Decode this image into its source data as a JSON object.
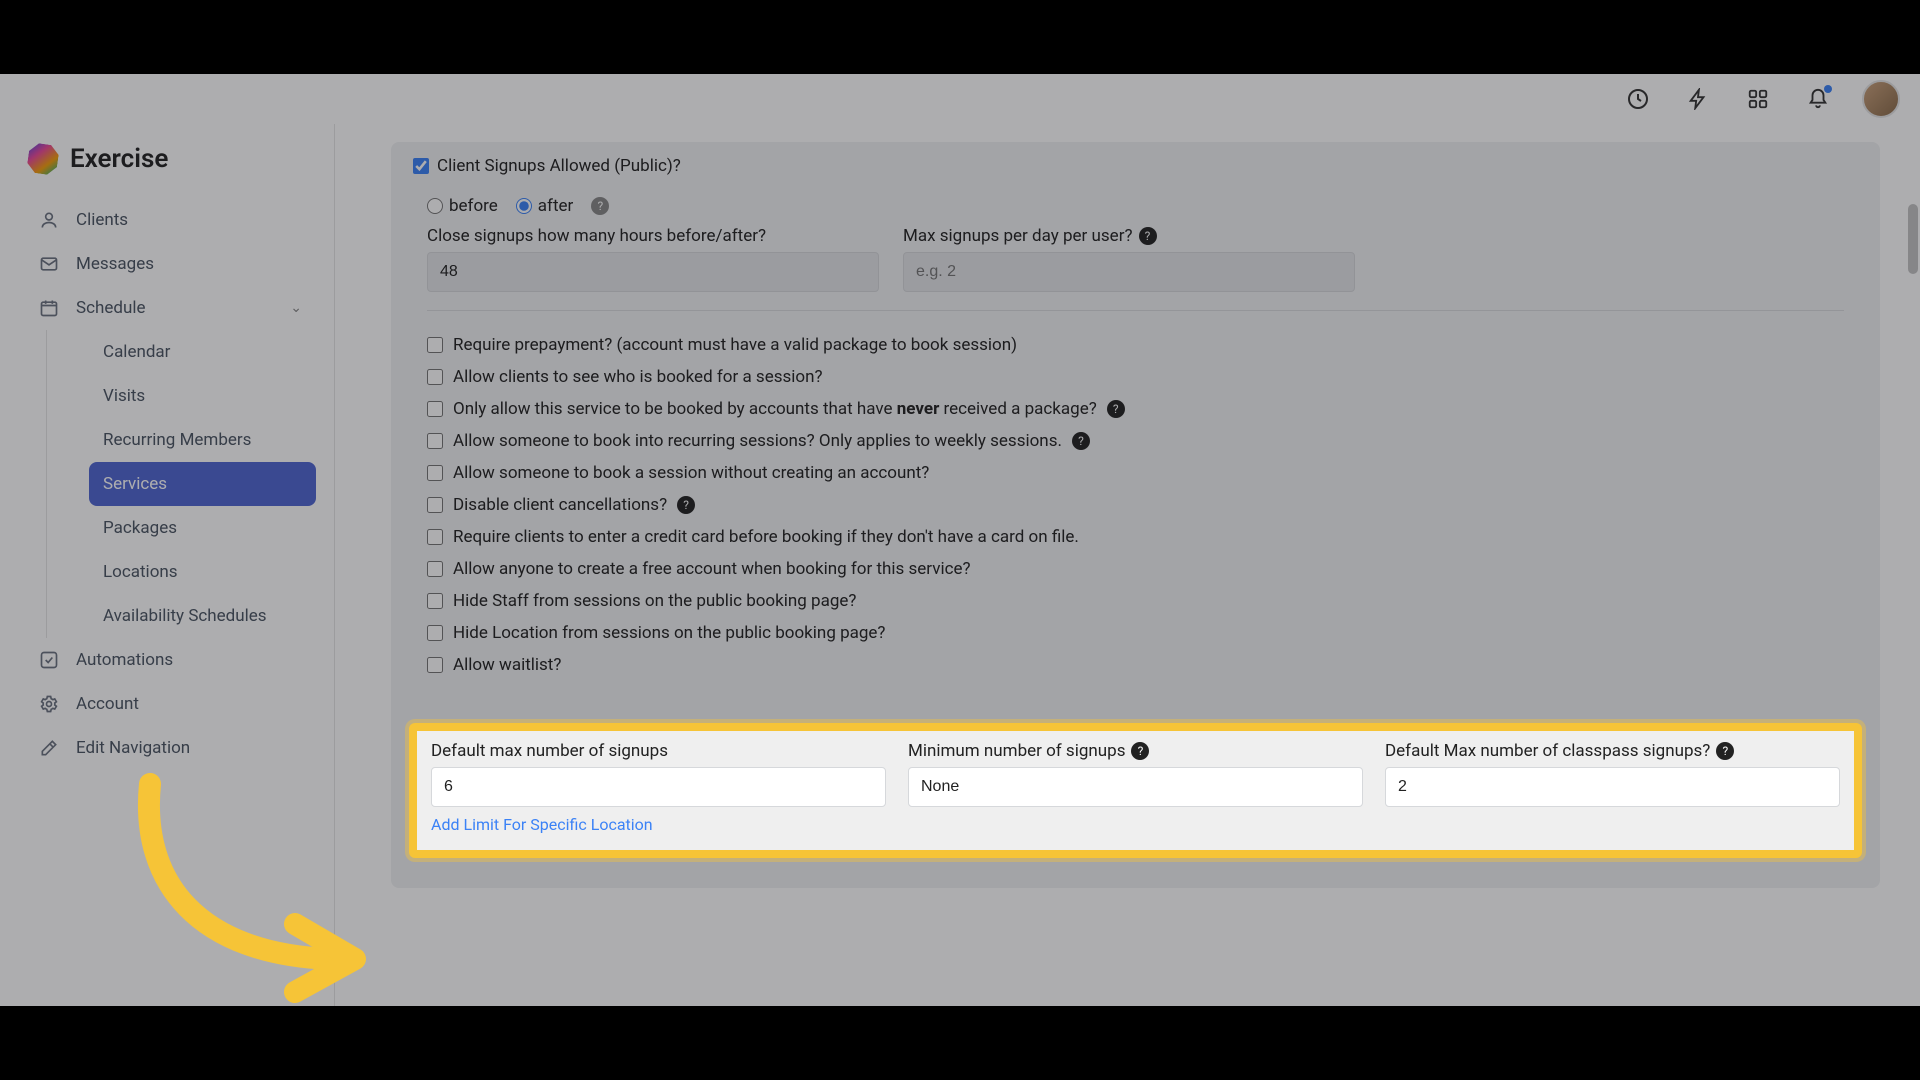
{
  "brand": {
    "name": "Exercise"
  },
  "sidebar": {
    "items": [
      {
        "icon": "person-icon",
        "label": "Clients"
      },
      {
        "icon": "mail-icon",
        "label": "Messages"
      },
      {
        "icon": "calendar-icon",
        "label": "Schedule",
        "expandable": true
      }
    ],
    "schedule_children": [
      {
        "label": "Calendar"
      },
      {
        "label": "Visits"
      },
      {
        "label": "Recurring Members"
      },
      {
        "label": "Services",
        "active": true
      },
      {
        "label": "Packages"
      },
      {
        "label": "Locations"
      },
      {
        "label": "Availability Schedules"
      }
    ],
    "items_tail": [
      {
        "icon": "check-square-icon",
        "label": "Automations"
      },
      {
        "icon": "gear-icon",
        "label": "Account"
      },
      {
        "icon": "edit-icon",
        "label": "Edit Navigation"
      }
    ]
  },
  "form": {
    "client_signups_label": "Client Signups Allowed (Public)?",
    "before_label": "before",
    "after_label": "after",
    "close_hours_label": "Close signups how many hours before/after?",
    "close_hours_value": "48",
    "max_per_day_label": "Max signups per day per user?",
    "max_per_day_placeholder": "e.g. 2",
    "checks": {
      "prepay": "Require prepayment? (account must have a valid package to book session)",
      "see_who": "Allow clients to see who is booked for a session?",
      "never_pkg_pre": "Only allow this service to be booked by accounts that have ",
      "never_pkg_strong": "never",
      "never_pkg_post": " received a package?",
      "recurring": "Allow someone to book into recurring sessions? Only applies to weekly sessions.",
      "no_account": "Allow someone to book a session without creating an account?",
      "disable_cancel": "Disable client cancellations?",
      "require_cc": "Require clients to enter a credit card before booking if they don't have a card on file.",
      "free_account": "Allow anyone to create a free account when booking for this service?",
      "hide_staff": "Hide Staff from sessions on the public booking page?",
      "hide_location": "Hide Location from sessions on the public booking page?",
      "waitlist": "Allow waitlist?"
    },
    "signup_limits": {
      "default_max_label": "Default max number of signups",
      "default_max_value": "6",
      "min_label": "Minimum number of signups",
      "min_value": "None",
      "classpass_label": "Default Max number of classpass signups?",
      "classpass_value": "2",
      "add_limit_link": "Add Limit For Specific Location"
    }
  }
}
